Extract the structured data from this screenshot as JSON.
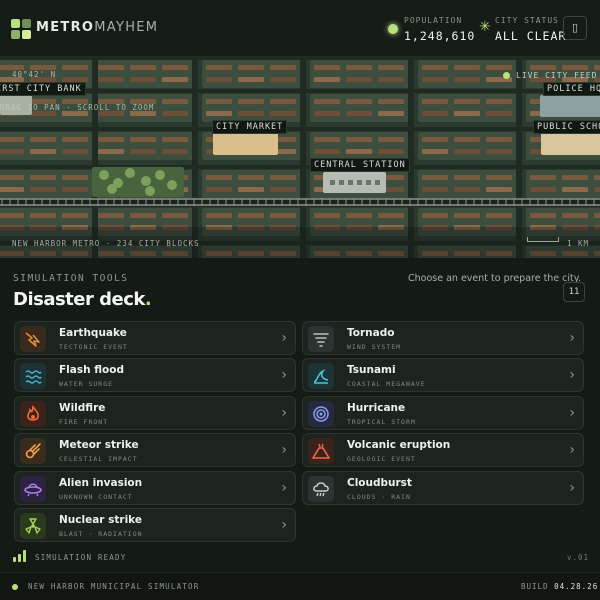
{
  "brand": {
    "part1": "METRO",
    "part2": "MAYHEM",
    "logo_colors": [
      "#b8e07c",
      "#6f8f5a",
      "#8fb066",
      "#d3ec9c"
    ]
  },
  "header": {
    "population_label": "POPULATION",
    "population_value": "1,248,610",
    "status_label": "CITY STATUS",
    "status_value": "ALL CLEAR",
    "status_icon": "asterisk-icon",
    "menu_icon": "phone-icon"
  },
  "map": {
    "coords": "40°42' N",
    "hint": "DRAG TO PAN · SCROLL TO ZOOM",
    "live_feed": "LIVE CITY FEED",
    "footer_left": "NEW HARBOR METRO · 234 CITY BLOCKS",
    "scale": "1 KM",
    "landmarks": {
      "bank": "FIRST CITY BANK",
      "police": "POLICE HQ",
      "market": "CITY MARKET",
      "school": "PUBLIC SCHOOL",
      "station": "CENTRAL STATION"
    }
  },
  "tools": {
    "label": "SIMULATION TOOLS",
    "title": "Disaster deck",
    "title_dot": ".",
    "hint": "Choose an event to prepare the city.",
    "count": "11",
    "cards": [
      {
        "name": "Earthquake",
        "sub": "TECTONIC EVENT",
        "icon": "earthquake-icon",
        "color": "#e08a3a",
        "bg": "#3a2a1e"
      },
      {
        "name": "Tornado",
        "sub": "WIND SYSTEM",
        "icon": "tornado-icon",
        "color": "#b9c2bd",
        "bg": "#2c3331"
      },
      {
        "name": "Flash flood",
        "sub": "WATER SURGE",
        "icon": "flood-icon",
        "color": "#4bb4c8",
        "bg": "#1c3236"
      },
      {
        "name": "Tsunami",
        "sub": "COASTAL MEGAWAVE",
        "icon": "tsunami-icon",
        "color": "#4bc4cf",
        "bg": "#1c3436"
      },
      {
        "name": "Wildfire",
        "sub": "FIRE FRONT",
        "icon": "fire-icon",
        "color": "#f06a3a",
        "bg": "#3b231b"
      },
      {
        "name": "Hurricane",
        "sub": "TROPICAL STORM",
        "icon": "hurricane-icon",
        "color": "#8a9cf0",
        "bg": "#252a40"
      },
      {
        "name": "Meteor strike",
        "sub": "CELESTIAL IMPACT",
        "icon": "meteor-icon",
        "color": "#f0a04a",
        "bg": "#3a2b1c"
      },
      {
        "name": "Volcanic eruption",
        "sub": "GEOLOGIC EVENT",
        "icon": "volcano-icon",
        "color": "#f0684a",
        "bg": "#3b221c"
      },
      {
        "name": "Alien invasion",
        "sub": "UNKNOWN CONTACT",
        "icon": "ufo-icon",
        "color": "#b07af0",
        "bg": "#2d2340"
      },
      {
        "name": "Cloudburst",
        "sub": "CLOUDS · RAIN",
        "icon": "cloud-rain-icon",
        "color": "#c7cfca",
        "bg": "#2c3331"
      },
      {
        "name": "Nuclear strike",
        "sub": "BLAST · RADIATION",
        "icon": "radiation-icon",
        "color": "#a6d65a",
        "bg": "#2b3a1c"
      }
    ]
  },
  "status": {
    "text": "SIMULATION READY",
    "version": "v.01",
    "signal_level": "3 of 3 bars"
  },
  "footer": {
    "left": "NEW HARBOR MUNICIPAL SIMULATOR",
    "build_label": "BUILD",
    "build_value": "04.28.26"
  }
}
